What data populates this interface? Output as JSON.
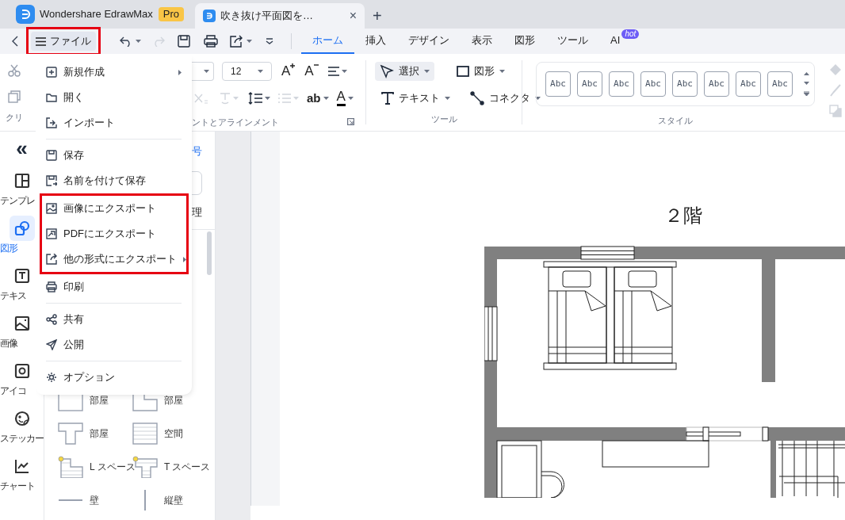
{
  "title_bar": {
    "app_name": "Wondershare EdrawMax",
    "plan_badge": "Pro",
    "document_tab": {
      "title": "吹き抜け平面図を…",
      "close": "×"
    },
    "new_tab": "+"
  },
  "toolbar": {
    "file_button": {
      "label": "ファイル",
      "highlighted": true
    },
    "tabs": [
      {
        "label": "ホーム",
        "selected": true
      },
      {
        "label": "挿入",
        "selected": false
      },
      {
        "label": "デザイン",
        "selected": false
      },
      {
        "label": "表示",
        "selected": false
      },
      {
        "label": "図形",
        "selected": false
      },
      {
        "label": "ツール",
        "selected": false
      },
      {
        "label": "AI",
        "selected": false,
        "badge": "hot"
      }
    ]
  },
  "ribbon": {
    "clipboard_label": "クリ",
    "font_size": "12",
    "grow_font": "A",
    "shrink_font": "A",
    "text_case": "ab",
    "font_color": "A",
    "font_group_label": "ントとアラインメント",
    "tools": [
      {
        "label": "選択",
        "selected": true
      },
      {
        "label": "図形",
        "selected": false
      },
      {
        "label": "テキスト",
        "selected": false
      },
      {
        "label": "コネクタ",
        "selected": false
      }
    ],
    "tools_label": "ツール",
    "styles": [
      "Abc",
      "Abc",
      "Abc",
      "Abc",
      "Abc",
      "Abc",
      "Abc",
      "Abc"
    ],
    "styles_label": "スタイル"
  },
  "left_rail": {
    "collapse": "«",
    "items": [
      {
        "label": "テンプレ",
        "selected": false
      },
      {
        "label": "図形",
        "selected": true
      },
      {
        "label": "テキス",
        "selected": false
      },
      {
        "label": "画像",
        "selected": false
      },
      {
        "label": "アイコ",
        "selected": false
      },
      {
        "label": "ステッカー",
        "selected": false
      },
      {
        "label": "チャート",
        "selected": false
      }
    ]
  },
  "library": {
    "link_fragment": "号",
    "section_fragment": "理",
    "shapes": [
      {
        "label": "部屋"
      },
      {
        "label": "部屋"
      },
      {
        "label": "部屋"
      },
      {
        "label": "空間"
      },
      {
        "label": "L スペース"
      },
      {
        "label": "T スペース"
      },
      {
        "label": "壁"
      },
      {
        "label": "縦壁"
      }
    ]
  },
  "canvas": {
    "page_title": "２階"
  },
  "file_menu": {
    "open": true,
    "groups": [
      {
        "highlighted": false,
        "divider_after": true,
        "items": [
          {
            "label": "新規作成",
            "submenu": true
          },
          {
            "label": "開く",
            "submenu": false
          },
          {
            "label": "インポート",
            "submenu": false
          }
        ]
      },
      {
        "highlighted": false,
        "divider_after": false,
        "items": [
          {
            "label": "保存",
            "submenu": false
          },
          {
            "label": "名前を付けて保存",
            "submenu": false
          }
        ]
      },
      {
        "highlighted": true,
        "divider_after": false,
        "items": [
          {
            "label": "画像にエクスポート",
            "submenu": false
          },
          {
            "label": "PDFにエクスポート",
            "submenu": false
          },
          {
            "label": "他の形式にエクスポート",
            "submenu": true
          }
        ]
      },
      {
        "highlighted": false,
        "divider_after": true,
        "items": [
          {
            "label": "印刷",
            "submenu": false
          }
        ]
      },
      {
        "highlighted": false,
        "divider_after": true,
        "items": [
          {
            "label": "共有",
            "submenu": false
          },
          {
            "label": "公開",
            "submenu": false
          }
        ]
      },
      {
        "highlighted": false,
        "divider_after": false,
        "items": [
          {
            "label": "オプション",
            "submenu": false
          }
        ]
      }
    ]
  }
}
